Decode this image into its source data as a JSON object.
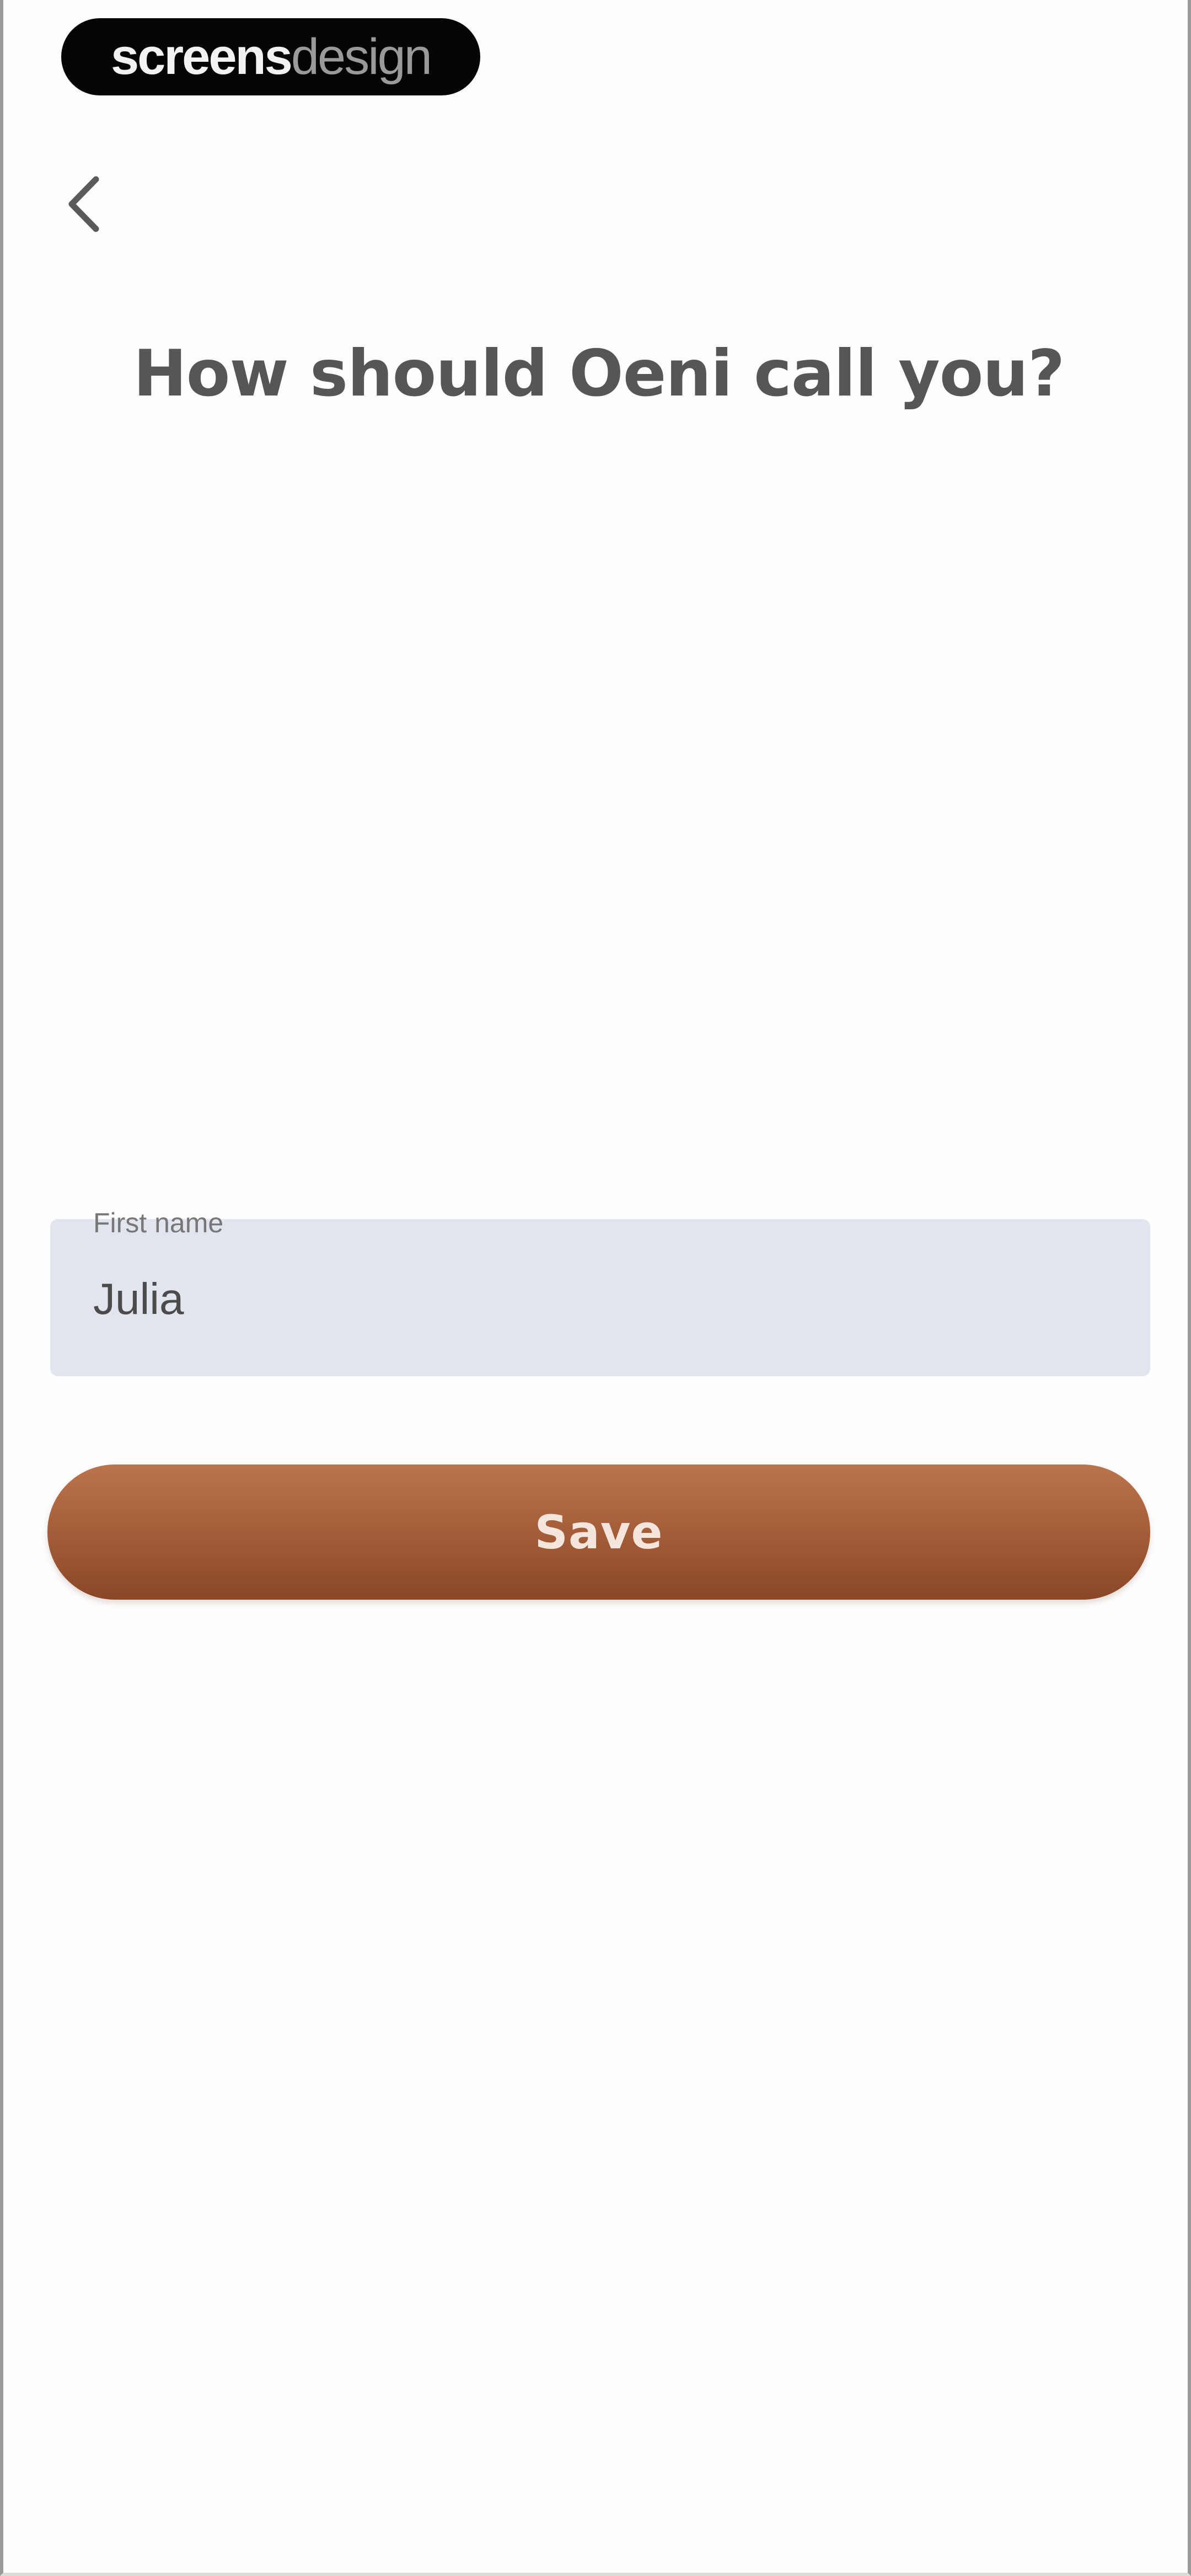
{
  "watermark": {
    "bold_text": "screens",
    "light_text": "design"
  },
  "header": {
    "back_icon": "chevron-left-icon"
  },
  "main": {
    "title": "How should Oeni call you?",
    "first_name_field": {
      "label": "First name",
      "value": "Julia"
    },
    "save_label": "Save"
  },
  "colors": {
    "accent": "#a25b36",
    "field_background": "#e2e5ee",
    "title_text": "#565656",
    "background": "#fdfdfe"
  }
}
